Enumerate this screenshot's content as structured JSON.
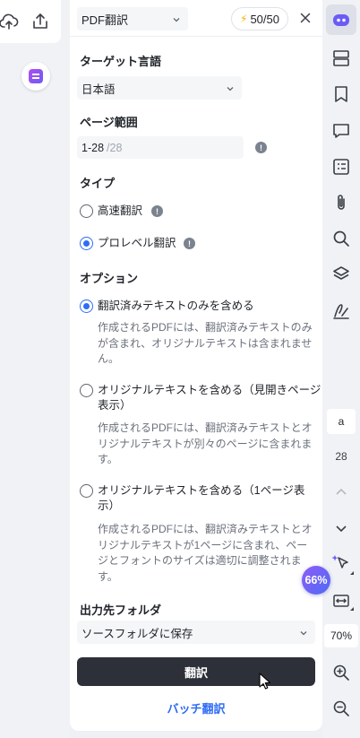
{
  "left": {
    "upload_icon": "cloud-upload-icon",
    "share_icon": "share-icon",
    "app_icon": "note-app-icon"
  },
  "header": {
    "mode": "PDF翻訳",
    "quota": "50/50",
    "bolt_icon": "lightning-icon",
    "close_icon": "close-icon"
  },
  "target_language": {
    "title": "ターゲット言語",
    "value": "日本語"
  },
  "page_range": {
    "title": "ページ範囲",
    "value": "1-28",
    "total": "/28",
    "info": "!"
  },
  "type": {
    "title": "タイプ",
    "options": [
      {
        "label": "高速翻訳",
        "checked": false,
        "info": "!"
      },
      {
        "label": "プロレベル翻訳",
        "checked": true,
        "info": "!"
      }
    ]
  },
  "options": {
    "title": "オプション",
    "items": [
      {
        "label": "翻訳済みテキストのみを含める",
        "checked": true,
        "desc": "作成されるPDFには、翻訳済みテキストのみが含まれ、オリジナルテキストは含まれません。"
      },
      {
        "label": "オリジナルテキストを含める（見開きページ表示）",
        "checked": false,
        "desc": "作成されるPDFには、翻訳済みテキストとオリジナルテキストが別々のページに含まれます。"
      },
      {
        "label": "オリジナルテキストを含める（1ページ表示）",
        "checked": false,
        "desc": "作成されるPDFには、翻訳済みテキストとオリジナルテキストが1ページに含まれ、ページとフォントのサイズは適切に調整されます。"
      }
    ]
  },
  "output_folder": {
    "title": "出力先フォルダ",
    "value": "ソースフォルダに保存"
  },
  "buttons": {
    "translate": "翻訳",
    "batch": "バッチ翻訳"
  },
  "right_bar": {
    "icons": [
      "ai-assistant-icon",
      "thumbnails-icon",
      "bookmark-icon",
      "comment-icon",
      "form-icon",
      "attachment-icon",
      "search-icon",
      "layers-icon",
      "signature-icon"
    ],
    "page_current": "a",
    "page_total": "28",
    "ai_percent": "66%",
    "zoom": "70%",
    "zoom_in_icon": "zoom-in-icon",
    "zoom_out_icon": "zoom-out-icon"
  },
  "colors": {
    "accent": "#2f6cf5",
    "button_dark": "#2e3039",
    "ai_gradient_start": "#8e5cf7",
    "ai_gradient_end": "#4e6bf5"
  }
}
